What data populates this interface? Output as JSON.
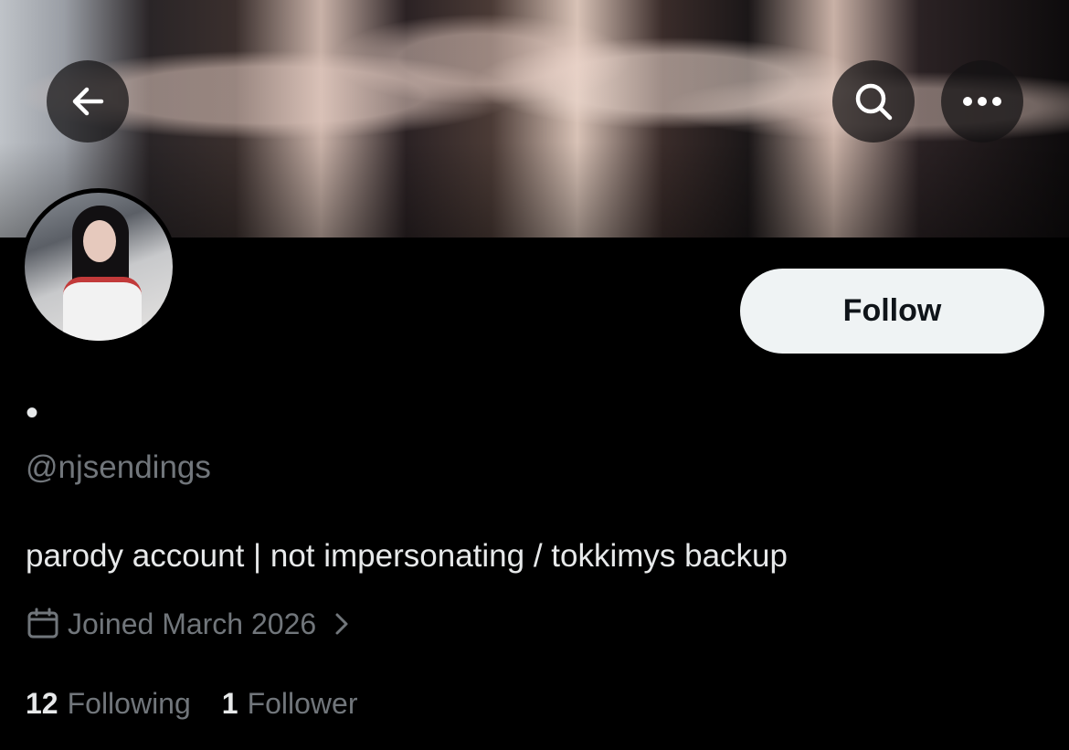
{
  "profile": {
    "display_name": "•",
    "handle": "@njsendings",
    "bio": "parody account | not impersonating / tokkimys backup",
    "joined": "Joined March 2026",
    "following_count": "12",
    "following_label": "Following",
    "followers_count": "1",
    "followers_label": "Follower"
  },
  "actions": {
    "follow_label": "Follow"
  },
  "icons": {
    "back": "arrow-left-icon",
    "search": "search-icon",
    "more": "more-icon",
    "calendar": "calendar-icon",
    "chevron": "chevron-right-icon"
  },
  "colors": {
    "background": "#000000",
    "primary_text": "#e7e9ea",
    "secondary_text": "#71767b",
    "follow_button": "#eff3f4"
  }
}
